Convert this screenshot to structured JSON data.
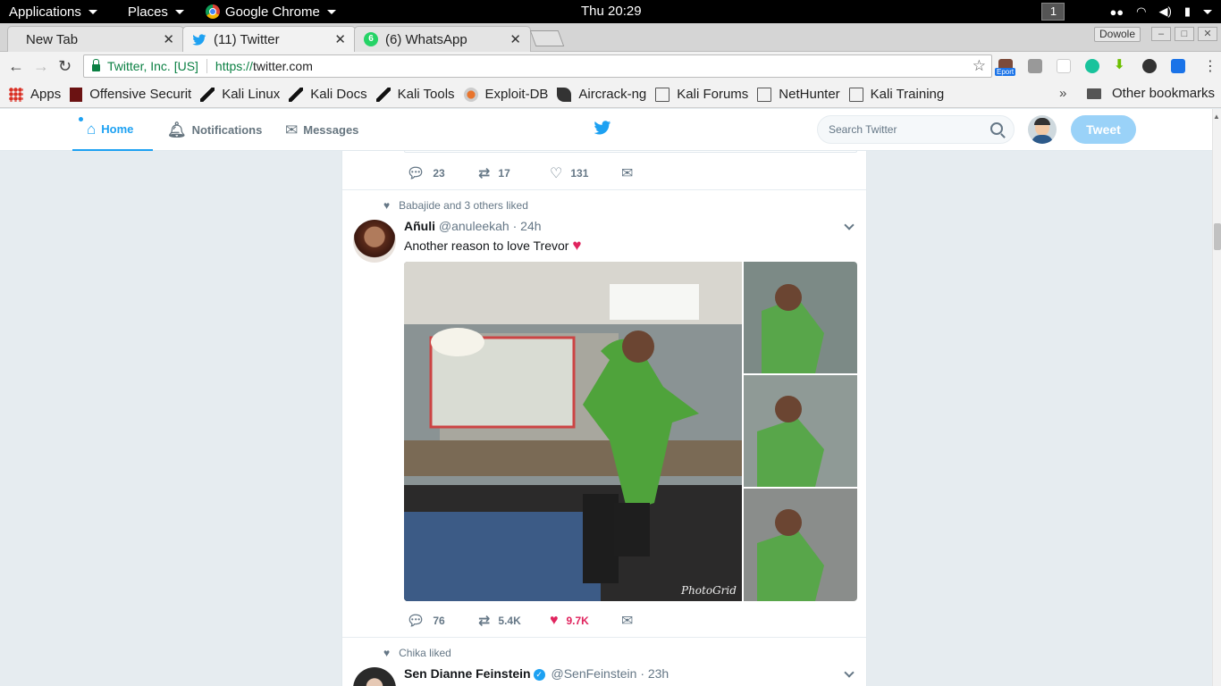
{
  "os_bar": {
    "applications": "Applications",
    "places": "Places",
    "active_app": "Google Chrome",
    "clock": "Thu 20:29",
    "workspace": "1"
  },
  "tabs": [
    {
      "label": "New Tab"
    },
    {
      "label": "(11) Twitter"
    },
    {
      "label": "(6) WhatsApp",
      "badge": "6"
    }
  ],
  "window": {
    "profile": "Dowole"
  },
  "omnibox": {
    "site_identity": "Twitter, Inc. [US]",
    "url_scheme": "https://",
    "url_host": "twitter.com"
  },
  "extensions": {
    "export_badge": "Eport"
  },
  "bookmarks": {
    "items": [
      "Apps",
      "Offensive Securit",
      "Kali Linux",
      "Kali Docs",
      "Kali Tools",
      "Exploit-DB",
      "Aircrack-ng",
      "Kali Forums",
      "NetHunter",
      "Kali Training"
    ],
    "more": "»",
    "other": "Other bookmarks"
  },
  "twitter_nav": {
    "home": "Home",
    "notifications": "Notifications",
    "messages": "Messages",
    "search_placeholder": "Search Twitter",
    "tweet_button": "Tweet"
  },
  "colors": {
    "twitter_blue": "#1da1f2",
    "like_red": "#e0245e",
    "text_gray": "#657786"
  },
  "timeline": {
    "prev_tweet_actions": {
      "replies": "23",
      "retweets": "17",
      "likes": "131"
    },
    "tweet1": {
      "context": "Babajide and 3 others liked",
      "fullname": "Añuli",
      "handle": "@anuleekah",
      "time": "· 24h",
      "text": "Another reason to love Trevor",
      "emoji": "♥",
      "watermark": "PhotoGrid",
      "replies": "76",
      "retweets": "5.4K",
      "likes": "9.7K"
    },
    "tweet2": {
      "context": "Chika liked",
      "fullname": "Sen Dianne Feinstein",
      "handle": "@SenFeinstein",
      "time": "· 23h"
    }
  }
}
